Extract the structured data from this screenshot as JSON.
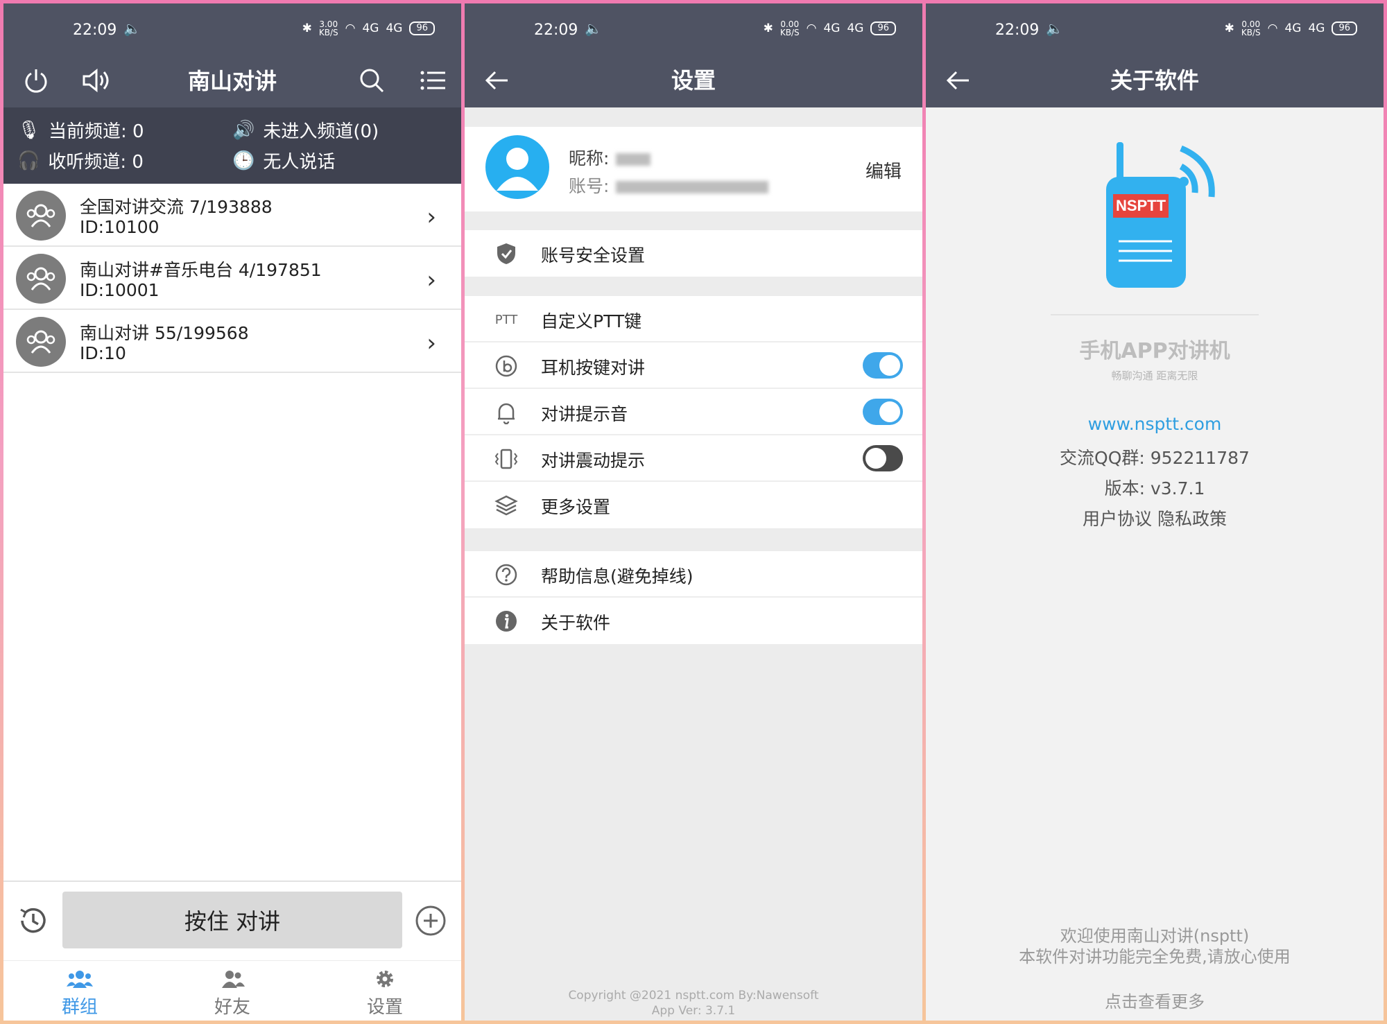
{
  "status": {
    "time": "22:09",
    "speed_main": "3.00",
    "speed_other": "0.00",
    "speed_unit": "KB/S",
    "signal1": "4G",
    "signal2": "4G",
    "battery": "96"
  },
  "screen1": {
    "title": "南山对讲",
    "current_channel": "当前频道: 0",
    "listen_channel": "收听频道: 0",
    "not_in_channel": "未进入频道(0)",
    "nobody_talking": "无人说话",
    "groups": [
      {
        "name": "全国对讲交流 7/193888",
        "id": "ID:10100"
      },
      {
        "name": "南山对讲#音乐电台 4/197851",
        "id": "ID:10001"
      },
      {
        "name": "南山对讲 55/199568",
        "id": "ID:10"
      }
    ],
    "ptt_label": "按住 对讲",
    "tabs": [
      {
        "label": "群组"
      },
      {
        "label": "好友"
      },
      {
        "label": "设置"
      }
    ],
    "accent": "#3f98e6"
  },
  "screen2": {
    "title": "设置",
    "nickname_label": "昵称:",
    "account_label": "账号:",
    "edit_label": "编辑",
    "account_security": "账号安全设置",
    "ptt_icon_text": "PTT",
    "custom_ptt": "自定义PTT键",
    "earphone_talk": "耳机按键对讲",
    "talk_tone": "对讲提示音",
    "talk_vibrate": "对讲震动提示",
    "more_settings": "更多设置",
    "help": "帮助信息(避免掉线)",
    "about": "关于软件",
    "copyright": "Copyright @2021 nsptt.com By:Nawensoft",
    "app_ver": "App Ver: 3.7.1",
    "toggles": {
      "earphone_talk": true,
      "talk_tone": true,
      "talk_vibrate": false
    }
  },
  "screen3": {
    "title": "关于软件",
    "logo_text": "NSPTT",
    "app_name": "手机APP对讲机",
    "tagline": "畅聊沟通 距离无限",
    "website": "www.nsptt.com",
    "qq_group": "交流QQ群: 952211787",
    "version": "版本: v3.7.1",
    "policy": "用户协议 隐私政策",
    "welcome": "欢迎使用南山对讲(nsptt)",
    "free_note": "本软件对讲功能完全免费,请放心使用",
    "more": "点击查看更多"
  }
}
